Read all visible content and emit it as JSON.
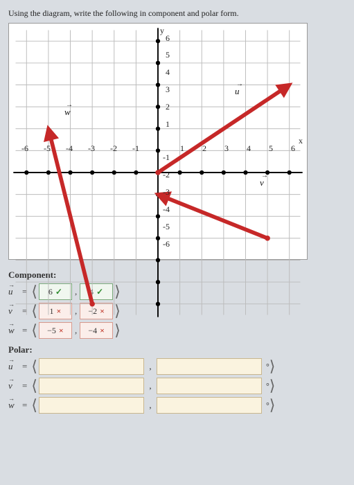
{
  "prompt": "Using the diagram, write the following in component and polar form.",
  "axes": {
    "y": "y",
    "x": "x",
    "yticks": [
      "6",
      "5",
      "4",
      "3",
      "2",
      "1",
      "-1",
      "-2",
      "-3",
      "-4",
      "-5",
      "-6"
    ],
    "xticks_left": [
      "-6",
      "-5",
      "-4",
      "-3",
      "-2",
      "-1"
    ],
    "xticks_right": [
      "1",
      "2",
      "3",
      "4",
      "5",
      "6"
    ]
  },
  "vectors": {
    "u": "u",
    "v": "v",
    "w": "w"
  },
  "sections": {
    "component": "Component:",
    "polar": "Polar:"
  },
  "component": {
    "u": {
      "a": "6",
      "a_mark": "✓",
      "a_ok": true,
      "b": "4",
      "b_mark": "✓",
      "b_ok": true
    },
    "v": {
      "a": "1",
      "a_mark": "×",
      "a_ok": false,
      "b": "−2",
      "b_mark": "×",
      "b_ok": false
    },
    "w": {
      "a": "−5",
      "a_mark": "×",
      "a_ok": false,
      "b": "−4",
      "b_mark": "×",
      "b_ok": false
    }
  },
  "polar": {
    "deg": "°"
  },
  "chart_data": {
    "type": "line",
    "title": "",
    "xlabel": "x",
    "ylabel": "y",
    "xlim": [
      -6.5,
      6.5
    ],
    "ylim": [
      -6.5,
      6.5
    ],
    "series": [
      {
        "name": "u",
        "x": [
          0,
          6
        ],
        "y": [
          0,
          4
        ]
      },
      {
        "name": "v",
        "x": [
          5,
          0
        ],
        "y": [
          -3,
          -1
        ]
      },
      {
        "name": "w",
        "x": [
          -3,
          -5
        ],
        "y": [
          -6,
          2
        ]
      }
    ]
  }
}
